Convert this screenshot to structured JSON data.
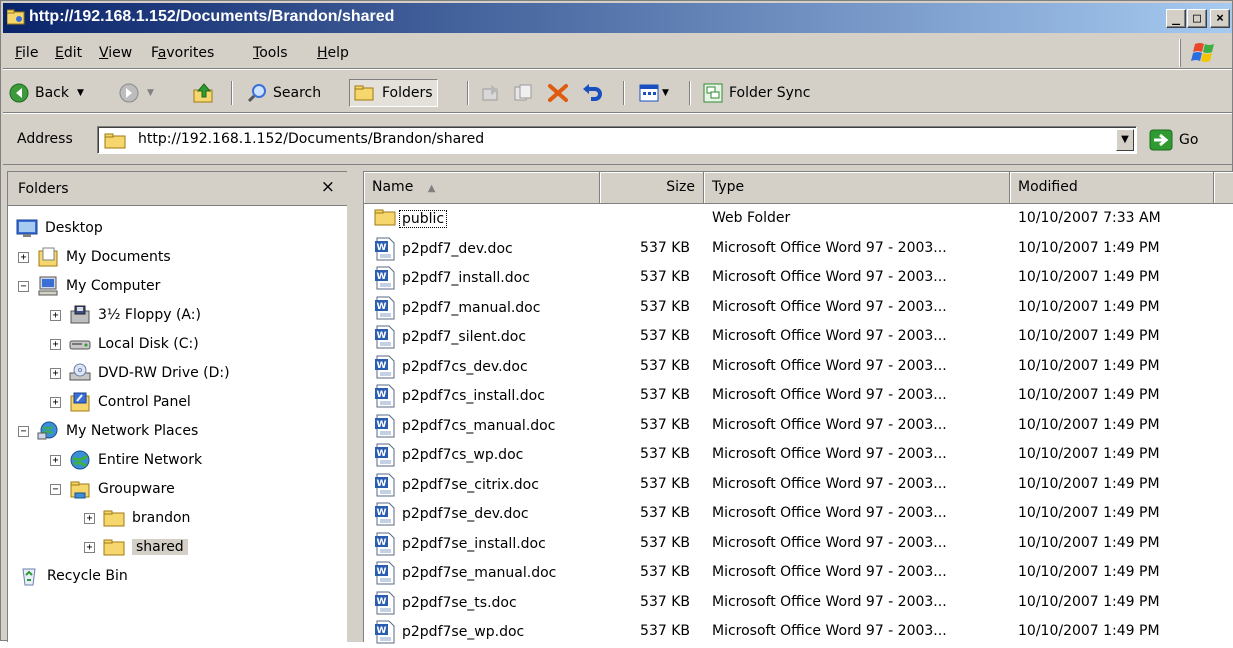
{
  "window": {
    "title": "http://192.168.1.152/Documents/Brandon/shared",
    "caption_buttons": {
      "minimize": "_",
      "maximize": "□",
      "close": "×"
    }
  },
  "menu": {
    "items": [
      {
        "label": "File"
      },
      {
        "label": "Edit"
      },
      {
        "label": "View"
      },
      {
        "label": "Favorites"
      },
      {
        "label": "Tools"
      },
      {
        "label": "Help"
      }
    ]
  },
  "toolbar": {
    "back_label": "Back",
    "search_label": "Search",
    "folders_label": "Folders",
    "folder_sync_label": "Folder Sync"
  },
  "address": {
    "label": "Address",
    "value": "http://192.168.1.152/Documents/Brandon/shared",
    "go_label": "Go"
  },
  "folders_pane": {
    "title": "Folders",
    "close_glyph": "×",
    "tree": [
      {
        "label": "Desktop",
        "icon": "desktop-icon",
        "expander": "",
        "level": 0
      },
      {
        "label": "My Documents",
        "icon": "my-documents-icon",
        "expander": "+",
        "level": 1
      },
      {
        "label": "My Computer",
        "icon": "my-computer-icon",
        "expander": "−",
        "level": 1
      },
      {
        "label": "3½ Floppy (A:)",
        "icon": "floppy-icon",
        "expander": "+",
        "level": 2
      },
      {
        "label": "Local Disk (C:)",
        "icon": "local-disk-icon",
        "expander": "+",
        "level": 2
      },
      {
        "label": "DVD-RW Drive (D:)",
        "icon": "dvd-drive-icon",
        "expander": "+",
        "level": 2
      },
      {
        "label": "Control Panel",
        "icon": "control-panel-icon",
        "expander": "+",
        "level": 2
      },
      {
        "label": "My Network Places",
        "icon": "network-places-icon",
        "expander": "−",
        "level": 1
      },
      {
        "label": "Entire Network",
        "icon": "entire-network-icon",
        "expander": "+",
        "level": 2
      },
      {
        "label": "Groupware",
        "icon": "groupware-icon",
        "expander": "−",
        "level": 2
      },
      {
        "label": "brandon",
        "icon": "folder-icon",
        "expander": "+",
        "level": 3
      },
      {
        "label": "shared",
        "icon": "folder-icon",
        "expander": "+",
        "level": 3,
        "selected": true
      },
      {
        "label": "Recycle Bin",
        "icon": "recycle-bin-icon",
        "expander": "",
        "level": 1
      }
    ]
  },
  "file_list": {
    "columns": {
      "name": "Name",
      "sort_indicator": "▲",
      "size": "Size",
      "type": "Type",
      "modified": "Modified"
    },
    "rows": [
      {
        "name": "public",
        "icon": "folder-icon",
        "size": "",
        "type": "Web Folder",
        "modified": "10/10/2007 7:33 AM"
      },
      {
        "name": "p2pdf7_dev.doc",
        "icon": "word-doc-icon",
        "size": "537 KB",
        "type": "Microsoft Office Word 97 - 2003...",
        "modified": "10/10/2007 1:49 PM"
      },
      {
        "name": "p2pdf7_install.doc",
        "icon": "word-doc-icon",
        "size": "537 KB",
        "type": "Microsoft Office Word 97 - 2003...",
        "modified": "10/10/2007 1:49 PM"
      },
      {
        "name": "p2pdf7_manual.doc",
        "icon": "word-doc-icon",
        "size": "537 KB",
        "type": "Microsoft Office Word 97 - 2003...",
        "modified": "10/10/2007 1:49 PM"
      },
      {
        "name": "p2pdf7_silent.doc",
        "icon": "word-doc-icon",
        "size": "537 KB",
        "type": "Microsoft Office Word 97 - 2003...",
        "modified": "10/10/2007 1:49 PM"
      },
      {
        "name": "p2pdf7cs_dev.doc",
        "icon": "word-doc-icon",
        "size": "537 KB",
        "type": "Microsoft Office Word 97 - 2003...",
        "modified": "10/10/2007 1:49 PM"
      },
      {
        "name": "p2pdf7cs_install.doc",
        "icon": "word-doc-icon",
        "size": "537 KB",
        "type": "Microsoft Office Word 97 - 2003...",
        "modified": "10/10/2007 1:49 PM"
      },
      {
        "name": "p2pdf7cs_manual.doc",
        "icon": "word-doc-icon",
        "size": "537 KB",
        "type": "Microsoft Office Word 97 - 2003...",
        "modified": "10/10/2007 1:49 PM"
      },
      {
        "name": "p2pdf7cs_wp.doc",
        "icon": "word-doc-icon",
        "size": "537 KB",
        "type": "Microsoft Office Word 97 - 2003...",
        "modified": "10/10/2007 1:49 PM"
      },
      {
        "name": "p2pdf7se_citrix.doc",
        "icon": "word-doc-icon",
        "size": "537 KB",
        "type": "Microsoft Office Word 97 - 2003...",
        "modified": "10/10/2007 1:49 PM"
      },
      {
        "name": "p2pdf7se_dev.doc",
        "icon": "word-doc-icon",
        "size": "537 KB",
        "type": "Microsoft Office Word 97 - 2003...",
        "modified": "10/10/2007 1:49 PM"
      },
      {
        "name": "p2pdf7se_install.doc",
        "icon": "word-doc-icon",
        "size": "537 KB",
        "type": "Microsoft Office Word 97 - 2003...",
        "modified": "10/10/2007 1:49 PM"
      },
      {
        "name": "p2pdf7se_manual.doc",
        "icon": "word-doc-icon",
        "size": "537 KB",
        "type": "Microsoft Office Word 97 - 2003...",
        "modified": "10/10/2007 1:49 PM"
      },
      {
        "name": "p2pdf7se_ts.doc",
        "icon": "word-doc-icon",
        "size": "537 KB",
        "type": "Microsoft Office Word 97 - 2003...",
        "modified": "10/10/2007 1:49 PM"
      },
      {
        "name": "p2pdf7se_wp.doc",
        "icon": "word-doc-icon",
        "size": "537 KB",
        "type": "Microsoft Office Word 97 - 2003...",
        "modified": "10/10/2007 1:49 PM"
      }
    ]
  },
  "colors": {
    "titlebar_start": "#0a246a",
    "titlebar_end": "#a6caf0",
    "chrome": "#d4d0c8",
    "folder_yellow": "#f5d76e",
    "word_blue": "#2a5db0"
  }
}
